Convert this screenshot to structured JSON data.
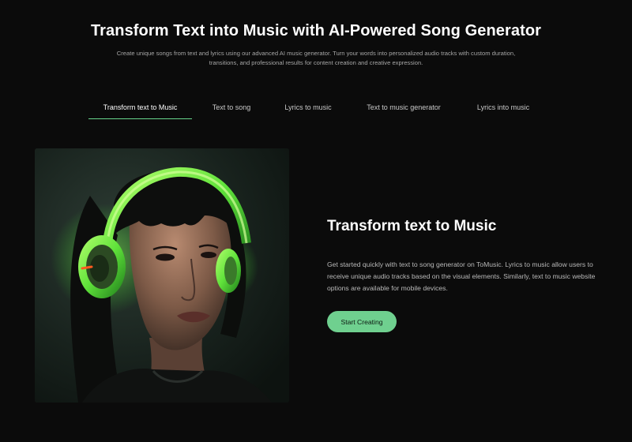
{
  "hero": {
    "title": "Transform Text into Music with AI-Powered Song Generator",
    "subtitle": "Create unique songs from text and lyrics using our advanced AI music generator. Turn your words into personalized audio tracks with custom duration, transitions, and professional results for content creation and creative expression."
  },
  "tabs": [
    {
      "label": "Transform text to Music",
      "active": true
    },
    {
      "label": "Text to song",
      "active": false
    },
    {
      "label": "Lyrics to music",
      "active": false
    },
    {
      "label": "Text to music generator",
      "active": false
    },
    {
      "label": "Lyrics into music",
      "active": false
    }
  ],
  "feature": {
    "image": "woman-with-green-headphones-image",
    "title": "Transform text to Music",
    "body": "Get started quickly with text to song generator on ToMusic. Lyrics to music allow users to receive unique audio tracks based on the visual elements. Similarly, text to music website options are available for mobile devices.",
    "cta_label": "Start Creating"
  },
  "colors": {
    "background": "#0b0b0b",
    "accent": "#6fd08f",
    "headphone_glow": "#6cff3a"
  }
}
